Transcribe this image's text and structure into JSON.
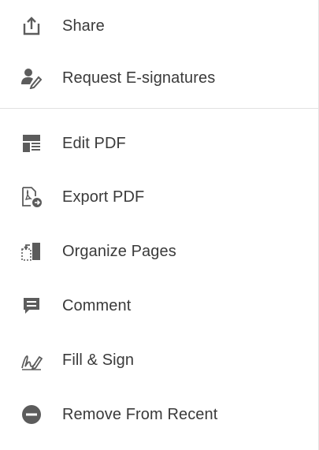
{
  "menu": {
    "items": [
      {
        "label": "Share",
        "icon": "share-icon"
      },
      {
        "label": "Request E-signatures",
        "icon": "request-esign-icon"
      },
      {
        "label": "Edit PDF",
        "icon": "edit-pdf-icon"
      },
      {
        "label": "Export PDF",
        "icon": "export-pdf-icon"
      },
      {
        "label": "Organize Pages",
        "icon": "organize-pages-icon"
      },
      {
        "label": "Comment",
        "icon": "comment-icon"
      },
      {
        "label": "Fill & Sign",
        "icon": "fill-sign-icon"
      },
      {
        "label": "Remove From Recent",
        "icon": "remove-icon"
      }
    ]
  },
  "colors": {
    "icon": "#5c5c5c",
    "text": "#3a3a3a",
    "divider": "#e1e1e1"
  }
}
